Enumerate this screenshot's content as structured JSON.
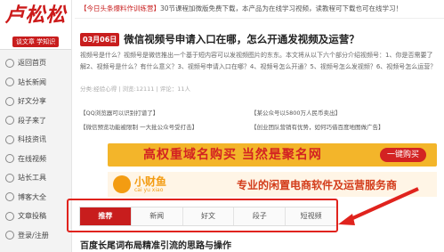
{
  "brand": {
    "logo": "卢松松",
    "slogan": "谈文章  学知识"
  },
  "sidebar": {
    "items": [
      {
        "label": "返回首页"
      },
      {
        "label": "站长新闻"
      },
      {
        "label": "好文分享"
      },
      {
        "label": "段子来了"
      },
      {
        "label": "科技资讯"
      },
      {
        "label": "在线视频"
      },
      {
        "label": "站长工具"
      },
      {
        "label": "博客大全"
      },
      {
        "label": "文章投稿"
      },
      {
        "label": "登录/注册"
      }
    ]
  },
  "topbar": {
    "highlight": "【今日头条爆料作训练营】",
    "rest": "30节课程加微版免费下载，本产品为在线学习视频，读教程可下载也可在线学习！"
  },
  "article": {
    "date": "03月06日",
    "title": "微信视频号申请入口在哪，怎么开通发视频及运营？",
    "excerpt": "视频号是什么？视频号是微信推出一个基于短内容可以发视频图片的东东。本文将从以下六个部分介绍视频号：1、你是否需要了解2、视频号是什么？有什么意义？3、视频号申请入口在哪？4、视频号怎么开通？5、视频号怎么发视频？6、视频号怎么运营？",
    "meta": "分类:经验心得 | 浏览:12111 | 评论：11人"
  },
  "related": [
    "【QQ浏览器可以识别打谱了】",
    "【某公众号以5800万人民币卖出】",
    "【微信预览功能被限制 一大批公众号受打击】",
    "【创业团队营销有优势，如何巧借百度地图做广告】"
  ],
  "ads": {
    "ad1_text": "高权重域名购买  当然是聚名网",
    "ad1_button": "一键购买",
    "ad2_name": "小财鱼",
    "ad2_sub": "cai yu xiao",
    "ad2_tagline": "专业的闲置电商软件及运营服务商"
  },
  "tabs": [
    "推荐",
    "新闻",
    "好文",
    "段子",
    "短视频"
  ],
  "next_article": {
    "title": "百度长尾词布局精准引流的思路与操作"
  },
  "colors": {
    "brand_red": "#c81d1d",
    "annotation_red": "#e0231d",
    "ad_yellow": "#f3b52a"
  }
}
